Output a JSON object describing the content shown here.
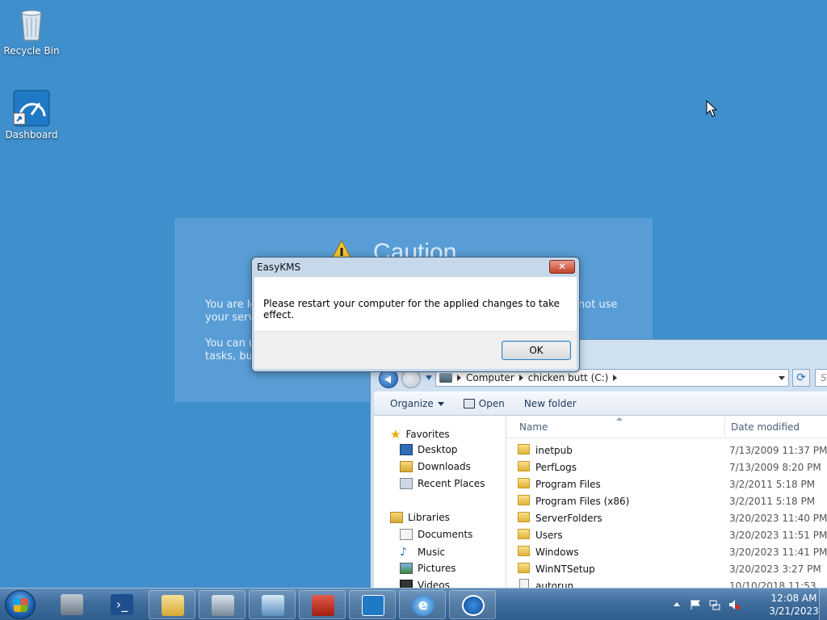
{
  "desktop": {
    "icons": [
      {
        "label": "Recycle Bin",
        "icon": "recycle-bin-icon"
      },
      {
        "label": "Dashboard",
        "icon": "dashboard-icon"
      }
    ],
    "background": "#3f8fcd"
  },
  "caution_panel": {
    "title": "Caution",
    "para1": "You are lo",
    "para1b": "not use",
    "para1c": "your serv",
    "para2": "You can u",
    "para2b": "tasks, but"
  },
  "dialog": {
    "title": "EasyKMS",
    "close_label": "✕",
    "message": "Please restart your computer for the applied changes to take effect.",
    "ok_label": "OK"
  },
  "explorer": {
    "breadcrumb": [
      "Computer",
      "chicken butt (C:)"
    ],
    "search_placeholder": "Se",
    "toolbar": {
      "organize": "Organize",
      "open": "Open",
      "new_folder": "New folder"
    },
    "nav": {
      "favorites": "Favorites",
      "desktop": "Desktop",
      "downloads": "Downloads",
      "recent": "Recent Places",
      "libraries": "Libraries",
      "documents": "Documents",
      "music": "Music",
      "pictures": "Pictures",
      "videos": "Videos"
    },
    "columns": {
      "name": "Name",
      "date": "Date modified"
    },
    "files": [
      {
        "name": "inetpub",
        "date": "7/13/2009 11:37 PM",
        "type": "folder"
      },
      {
        "name": "PerfLogs",
        "date": "7/13/2009 8:20 PM",
        "type": "folder"
      },
      {
        "name": "Program Files",
        "date": "3/2/2011 5:18 PM",
        "type": "folder"
      },
      {
        "name": "Program Files (x86)",
        "date": "3/2/2011 5:18 PM",
        "type": "folder"
      },
      {
        "name": "ServerFolders",
        "date": "3/20/2023 11:40 PM",
        "type": "folder"
      },
      {
        "name": "Users",
        "date": "3/20/2023 11:51 PM",
        "type": "folder"
      },
      {
        "name": "Windows",
        "date": "3/20/2023 11:41 PM",
        "type": "folder"
      },
      {
        "name": "WinNTSetup",
        "date": "3/20/2023 3:27 PM",
        "type": "folder"
      },
      {
        "name": "autorun",
        "date": "10/10/2018 11:53",
        "type": "file"
      }
    ]
  },
  "taskbar": {
    "clock_time": "12:08 AM",
    "clock_date": "3/21/2023",
    "apps": [
      "server-manager-icon",
      "powershell-icon",
      "file-explorer-icon",
      "control-panel-icon",
      "remote-desktop-icon",
      "toolbox-icon",
      "dashboard-icon",
      "internet-explorer-icon",
      "easykms-icon"
    ]
  }
}
